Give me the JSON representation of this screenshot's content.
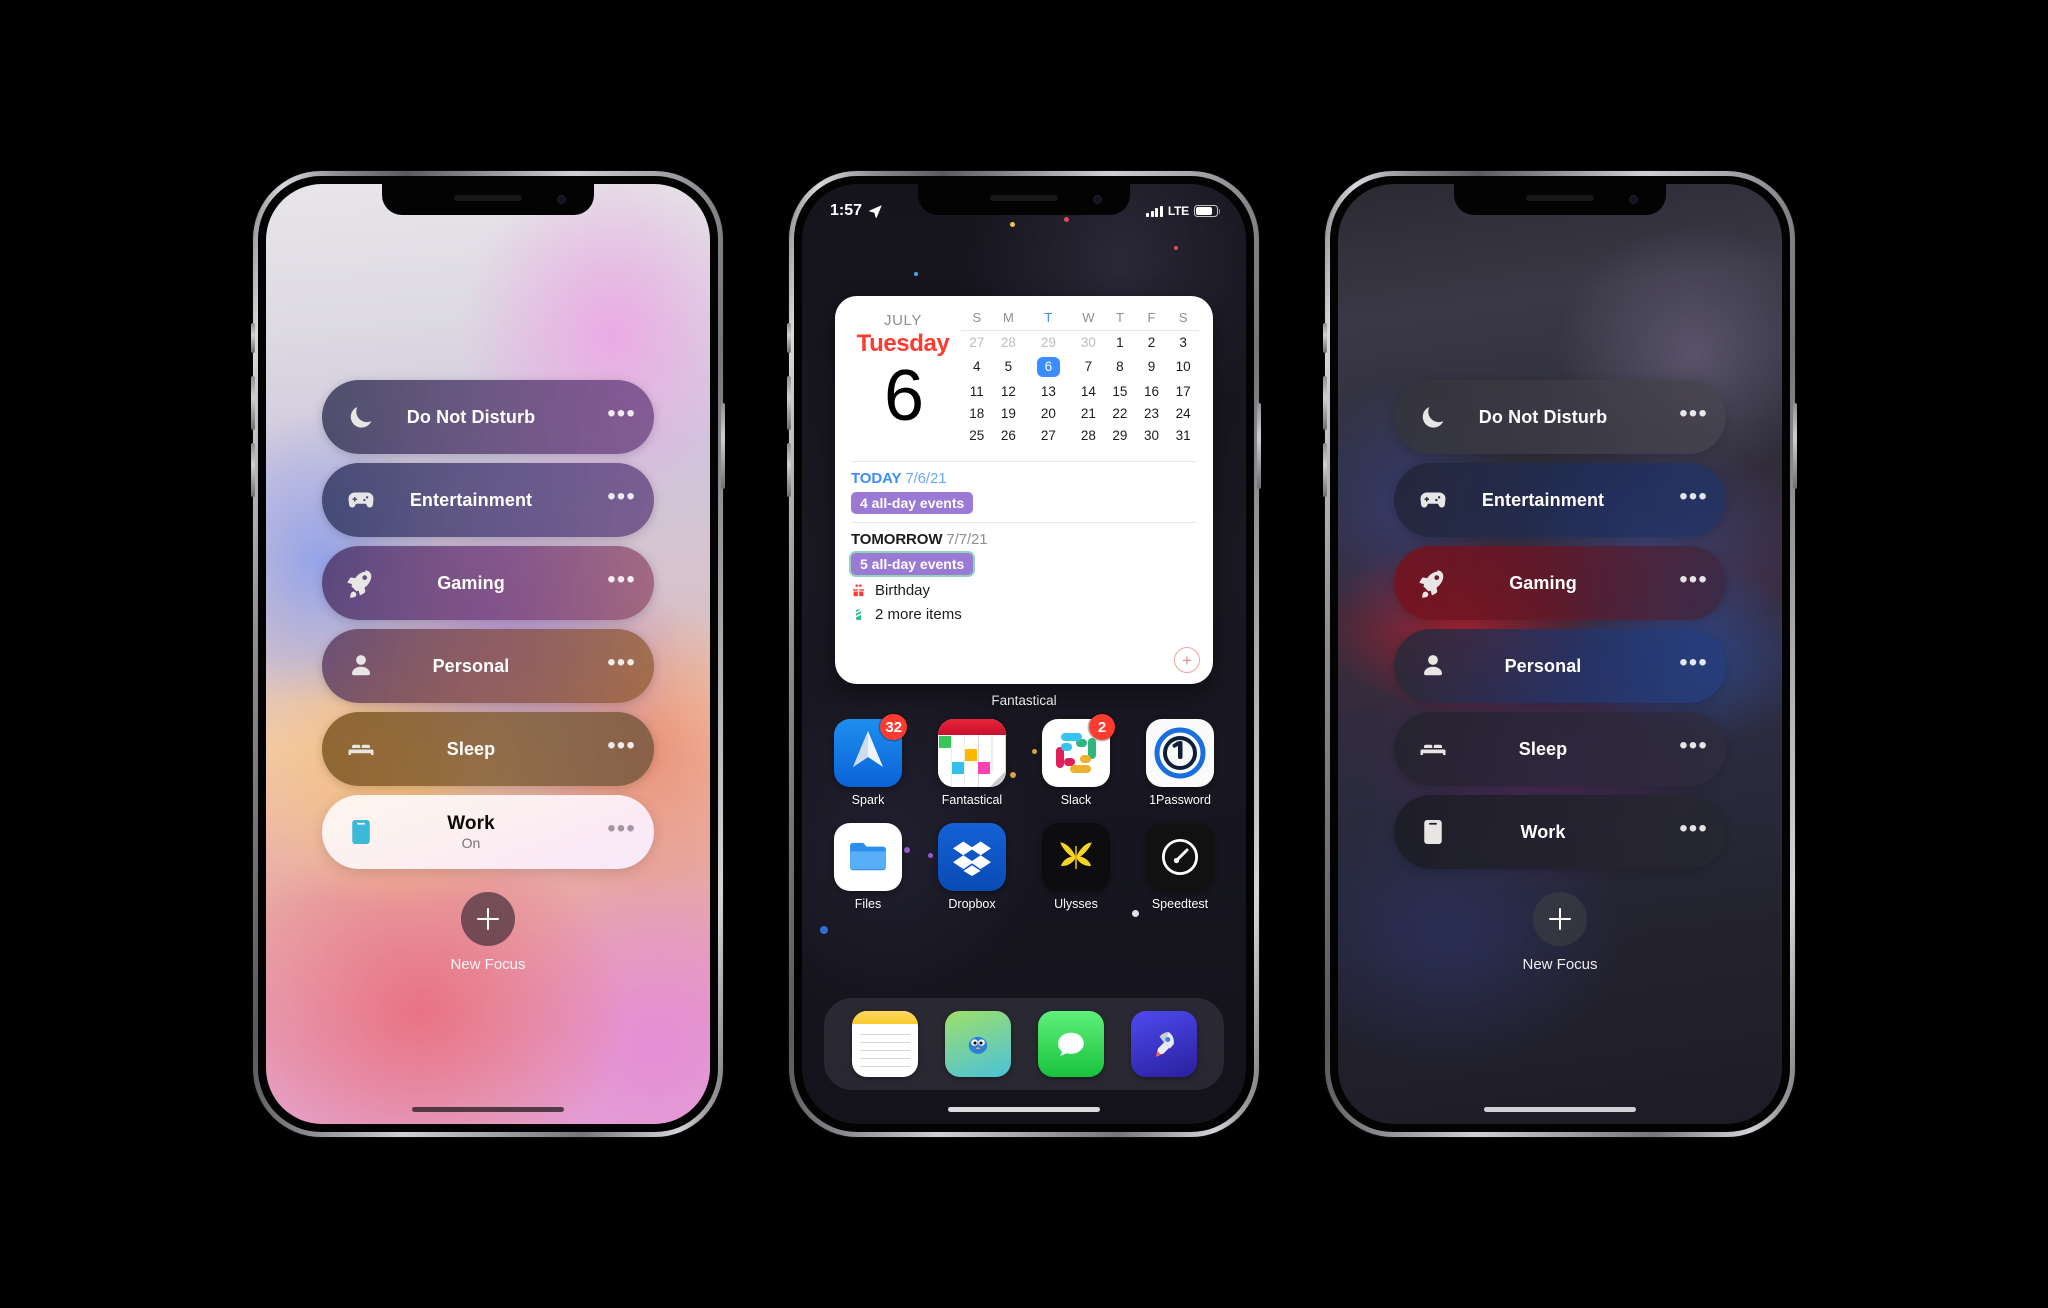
{
  "focus": {
    "items": [
      {
        "label": "Do Not Disturb",
        "icon": "moon-icon",
        "state": "off",
        "menu": "•••"
      },
      {
        "label": "Entertainment",
        "icon": "gamecontroller-icon",
        "state": "off",
        "menu": "•••"
      },
      {
        "label": "Gaming",
        "icon": "rocket-icon",
        "state": "off",
        "menu": "•••"
      },
      {
        "label": "Personal",
        "icon": "person-icon",
        "state": "off",
        "menu": "•••"
      },
      {
        "label": "Sleep",
        "icon": "bed-icon",
        "state": "off",
        "menu": "•••"
      },
      {
        "label": "Work",
        "icon": "id-card-icon",
        "state": "On",
        "menu": "•••"
      }
    ],
    "new_focus_label": "New Focus",
    "new_focus_icon": "plus-icon",
    "accent_active_icon_color": "#3cb8d8"
  },
  "home": {
    "statusbar": {
      "time": "1:57",
      "location_icon": "location-arrow-icon",
      "signal_icon": "cellular-bars-icon",
      "carrier": "LTE",
      "battery_icon": "battery-icon"
    },
    "widget": {
      "app_label": "Fantastical",
      "month": "JULY",
      "weekday": "Tuesday",
      "day_number": "6",
      "weekday_headers": [
        "S",
        "M",
        "T",
        "W",
        "T",
        "F",
        "S"
      ],
      "highlighted_header_index": 2,
      "weeks": [
        [
          "27",
          "28",
          "29",
          "30",
          "1",
          "2",
          "3"
        ],
        [
          "4",
          "5",
          "6",
          "7",
          "8",
          "9",
          "10"
        ],
        [
          "11",
          "12",
          "13",
          "14",
          "15",
          "16",
          "17"
        ],
        [
          "18",
          "19",
          "20",
          "21",
          "22",
          "23",
          "24"
        ],
        [
          "25",
          "26",
          "27",
          "28",
          "29",
          "30",
          "31"
        ]
      ],
      "dim_cells": [
        "0-0",
        "0-1",
        "0-2",
        "0-3"
      ],
      "today_cell": "1-2",
      "today_color": "#3b8cff",
      "weekday_color": "#ff3b30",
      "sections": [
        {
          "title": "TODAY",
          "date": "7/6/21",
          "badge": "4 all-day events",
          "outlined": false
        },
        {
          "title": "TOMORROW",
          "date": "7/7/21",
          "badge": "5 all-day events",
          "outlined": true
        }
      ],
      "rows": [
        {
          "icon": "gift-icon",
          "text": "Birthday"
        },
        {
          "icon": "candle-icon",
          "text": "2 more items"
        }
      ],
      "add_button_label": "+",
      "badge_color": "#9b7ad6"
    },
    "apps_row1": [
      {
        "name": "Spark",
        "icon": "spark-icon",
        "badge": "32",
        "dot": false
      },
      {
        "name": "Fantastical",
        "icon": "fantastical-icon",
        "badge": null,
        "dot": false
      },
      {
        "name": "Slack",
        "icon": "slack-icon",
        "badge": "2",
        "dot": true
      },
      {
        "name": "1Password",
        "icon": "1password-icon",
        "badge": null,
        "dot": false
      }
    ],
    "apps_row2": [
      {
        "name": "Files",
        "icon": "files-icon",
        "badge": null,
        "dot": false
      },
      {
        "name": "Dropbox",
        "icon": "dropbox-icon",
        "badge": null,
        "dot": true
      },
      {
        "name": "Ulysses",
        "icon": "ulysses-icon",
        "badge": null,
        "dot": false
      },
      {
        "name": "Speedtest",
        "icon": "speedtest-icon",
        "badge": null,
        "dot": false
      }
    ],
    "dock": [
      {
        "name": "Notes",
        "icon": "notes-icon"
      },
      {
        "name": "Tweetbot",
        "icon": "tweetbot-icon"
      },
      {
        "name": "Messages",
        "icon": "messages-icon"
      },
      {
        "name": "Rocket",
        "icon": "rocket-app-icon"
      }
    ]
  }
}
